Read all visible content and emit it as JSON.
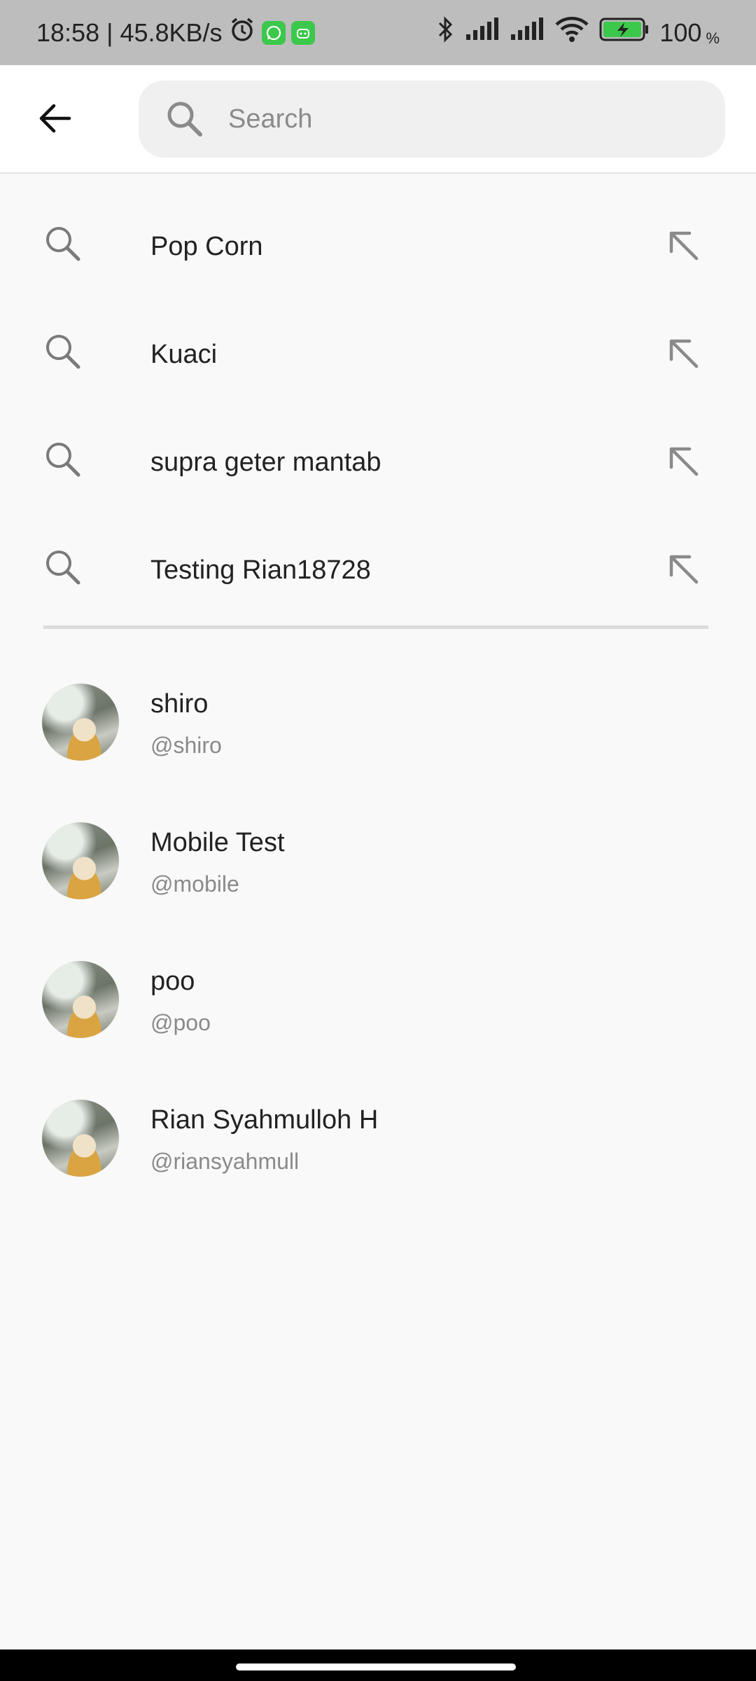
{
  "status_bar": {
    "time_speed": "18:58 | 45.8KB/s",
    "battery": "100",
    "battery_unit": "%",
    "icons": [
      "alarm-icon",
      "whatsapp-icon",
      "android-icon",
      "bluetooth-icon",
      "signal-icon",
      "signal-icon",
      "wifi-icon",
      "battery-charging-icon"
    ]
  },
  "header": {
    "search_placeholder": "Search"
  },
  "history": [
    {
      "label": "Pop Corn"
    },
    {
      "label": "Kuaci"
    },
    {
      "label": "supra geter mantab"
    },
    {
      "label": "Testing Rian18728"
    }
  ],
  "users": [
    {
      "name": "shiro",
      "handle": "@shiro"
    },
    {
      "name": "Mobile Test",
      "handle": "@mobile"
    },
    {
      "name": "poo",
      "handle": "@poo"
    },
    {
      "name": "Rian Syahmulloh H",
      "handle": "@riansyahmull"
    }
  ],
  "colors": {
    "background": "#f9f9f9",
    "statusbar": "#bdbdbd",
    "accent_green": "#3cc84b"
  }
}
